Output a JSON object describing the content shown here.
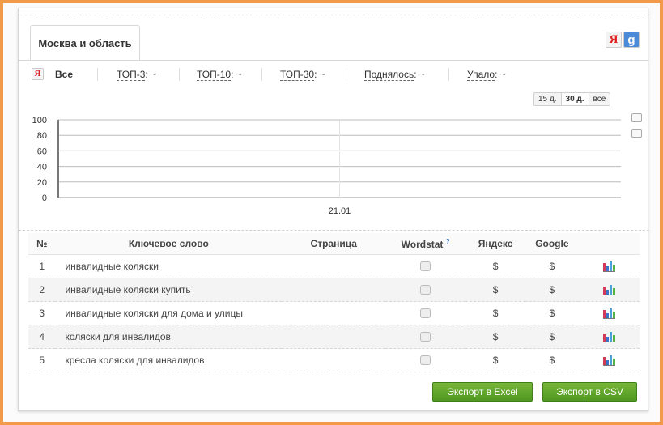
{
  "region_tab": "Москва и область",
  "engines": {
    "yandex": "Я",
    "google": "g"
  },
  "filters": {
    "yandex_icon": "Я",
    "all": "Все",
    "top3": "ТОП-3",
    "top10": "ТОП-10",
    "top30": "ТОП-30",
    "rose": "Поднялось",
    "fell": "Упало",
    "value": ": ~"
  },
  "ranges": [
    "15 д.",
    "30 д.",
    "все"
  ],
  "active_range": "30 д.",
  "chart_data": {
    "type": "line",
    "title": "",
    "xlabel": "",
    "ylabel": "",
    "x": [
      "21.01"
    ],
    "series": [],
    "yticks": [
      "100",
      "80",
      "60",
      "40",
      "20",
      "0"
    ],
    "ylim": [
      0,
      100
    ],
    "grid": true
  },
  "table": {
    "headers": {
      "num": "№",
      "keyword": "Ключевое слово",
      "page": "Страница",
      "wordstat": "Wordstat",
      "wordstat_hint": "?",
      "yandex": "Яндекс",
      "google": "Google"
    },
    "rows": [
      {
        "num": "1",
        "keyword": "инвалидные коляски",
        "page": "",
        "yandex": "$",
        "google": "$"
      },
      {
        "num": "2",
        "keyword": "инвалидные коляски купить",
        "page": "",
        "yandex": "$",
        "google": "$"
      },
      {
        "num": "3",
        "keyword": "инвалидные коляски для дома и улицы",
        "page": "",
        "yandex": "$",
        "google": "$"
      },
      {
        "num": "4",
        "keyword": "коляски для инвалидов",
        "page": "",
        "yandex": "$",
        "google": "$"
      },
      {
        "num": "5",
        "keyword": "кресла коляски для инвалидов",
        "page": "",
        "yandex": "$",
        "google": "$"
      }
    ]
  },
  "buttons": {
    "excel": "Экспорт в Excel",
    "csv": "Экспорт в CSV"
  },
  "colors": {
    "frame": "#f29a4a",
    "button_green": "#5da22a",
    "yandex_red": "#dd2222",
    "google_blue": "#4a8ad9"
  }
}
